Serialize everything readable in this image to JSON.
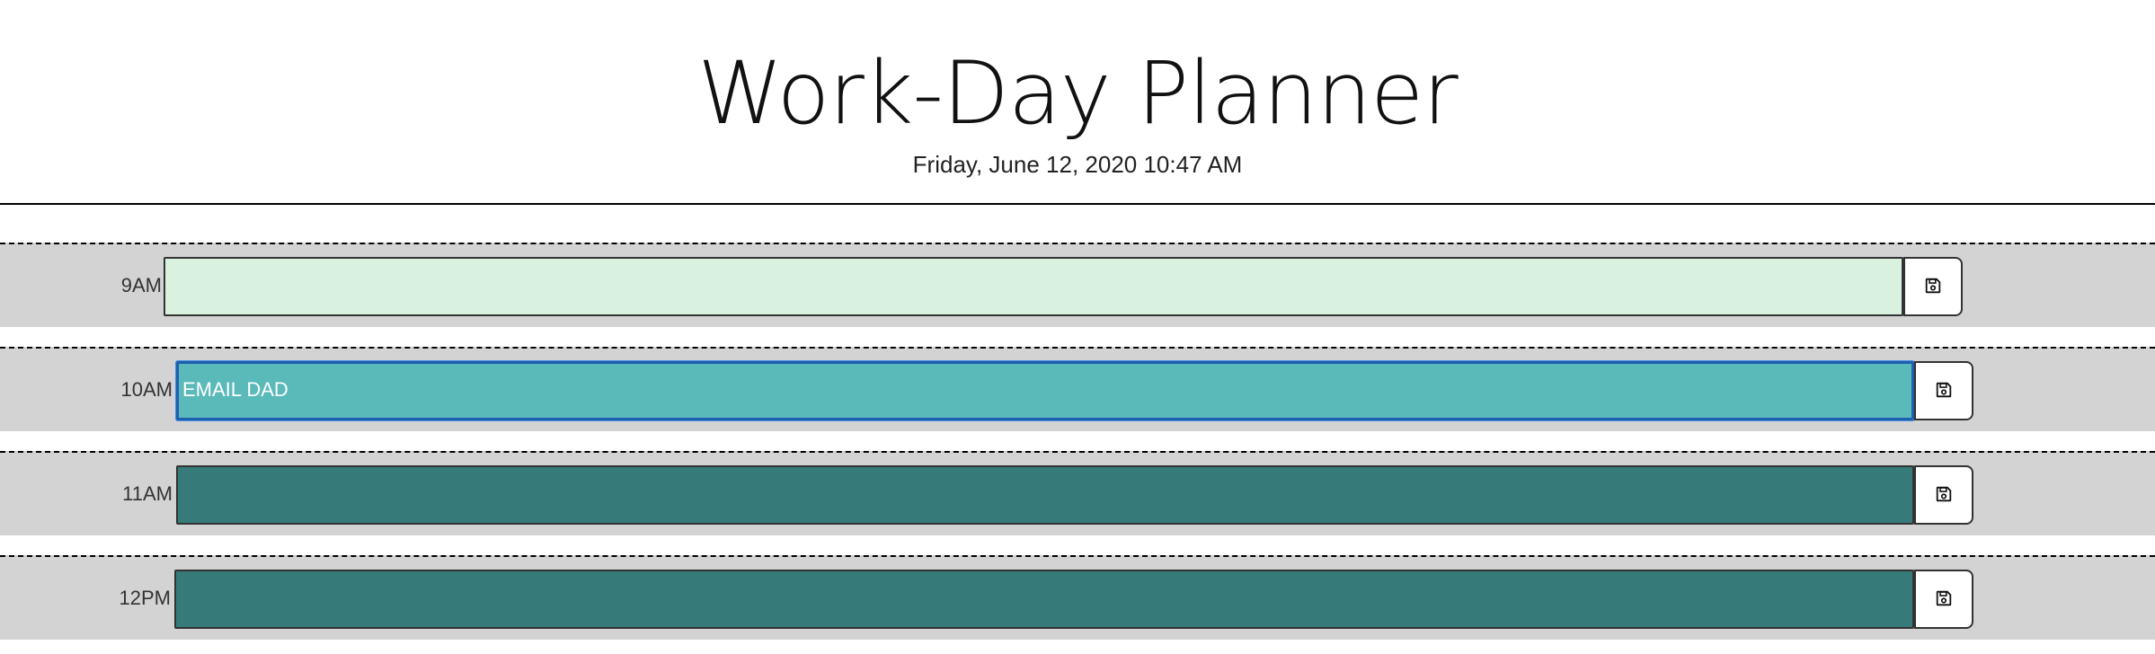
{
  "header": {
    "title": "Work-Day Planner",
    "current_day": "Friday, June 12, 2020 10:47 AM"
  },
  "time_blocks": [
    {
      "hour": "9AM",
      "text": "",
      "status": "past"
    },
    {
      "hour": "10AM",
      "text": "EMAIL DAD",
      "status": "present"
    },
    {
      "hour": "11AM",
      "text": "",
      "status": "future"
    },
    {
      "hour": "12PM",
      "text": "",
      "status": "future"
    }
  ],
  "save_icon": "floppy-disk-icon",
  "colors": {
    "past": "#d9f2df",
    "present": "#5ab9b9",
    "future": "#367a79",
    "row_background": "#d3d3d3"
  }
}
